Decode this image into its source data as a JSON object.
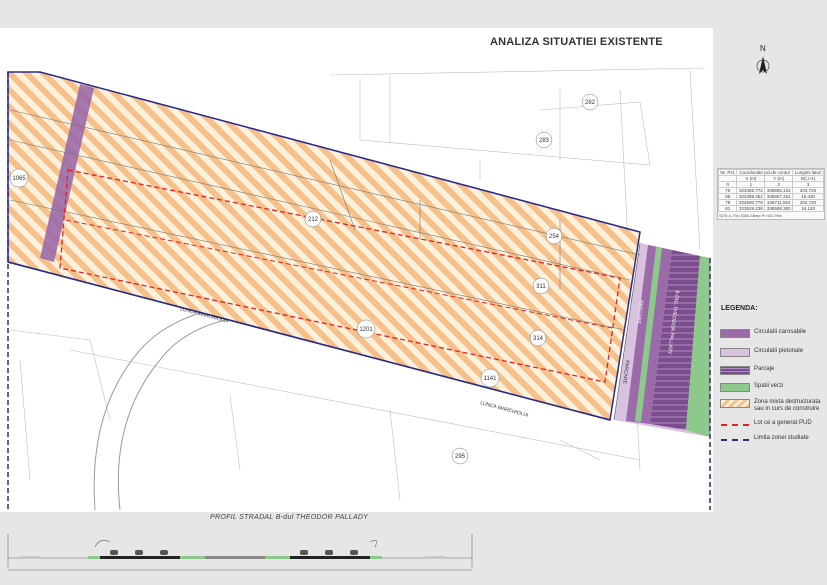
{
  "title": "ANALIZA SITUATIEI EXISTENTE",
  "north_label": "N",
  "map_labels": {
    "lunca_1": "LUNCA MARCHIOLUI",
    "lunca_2": "LUNCA MARCHIOLUI",
    "street_vertical": "B-DUL THEODOR PALLADY",
    "parcel_212": "212",
    "parcel_254": "254",
    "parcel_311": "311",
    "parcel_314": "314",
    "parcel_1201": "1201",
    "parcel_1141": "1141",
    "parcel_282": "282",
    "parcel_283": "283",
    "parcel_1065": "1065",
    "parcel_295": "295",
    "parcare": "PARCARE",
    "pietonal": "PARCARE"
  },
  "coord_table": {
    "headers": [
      "Nr. Pct.",
      "Coordonate pct.de contur",
      "",
      "Lungimi laturi"
    ],
    "subheaders": [
      "",
      "X (m)",
      "Y (m)",
      "D(i,i+1)"
    ],
    "index_row": [
      "0",
      "1",
      "2",
      "3"
    ],
    "rows": [
      [
        "76",
        "323455.772",
        "338656.134",
        "204.720"
      ],
      [
        "85",
        "323489.452",
        "338657.261",
        "16.430"
      ],
      [
        "79",
        "323500.776",
        "338711.064",
        "204.720"
      ],
      [
        "81",
        "323529.238",
        "338588.300",
        "16.120"
      ]
    ],
    "footer": "S(76-4-79)=3306.58mp  P=441.99m"
  },
  "legend": {
    "title": "LEGENDA:",
    "items": [
      {
        "label": "Circulatii carosabile",
        "color": "#9b6aa8"
      },
      {
        "label": "Circulatii pietonale",
        "color": "#d9c2e0"
      },
      {
        "label": "Parcaje",
        "color": "#7a4d8c"
      },
      {
        "label": "Spatii verzi",
        "color": "#8dc98a"
      },
      {
        "label": "Zona mixta destructurata sau in curs de construire",
        "color": "#f5c08a"
      },
      {
        "label": "Lot ce a generat PUD",
        "color": "#e32222"
      },
      {
        "label": "Limita zonei studiate",
        "color": "#2a2a8c"
      }
    ]
  },
  "profile": {
    "title": "PROFIL  STRADAL  B-dul THEODOR PALLADY"
  }
}
